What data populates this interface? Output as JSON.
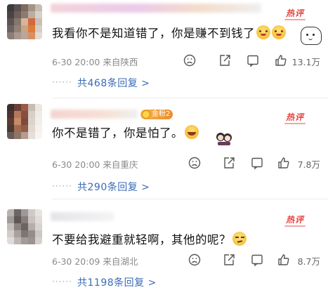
{
  "comments": [
    {
      "text": "我看你不是知道错了，你是赚不到钱了",
      "hot_label": "热评",
      "meta": "6-30 20:00 来自陕西",
      "likes": "13.1万",
      "replies": "共468条回复 >",
      "dots": "······"
    },
    {
      "text": "你不是错了，你是怕了。",
      "hot_label": "热评",
      "badge": "金粉2",
      "meta": "6-30 20:00 来自重庆",
      "likes": "7.8万",
      "replies": "共290条回复 >",
      "dots": "······"
    },
    {
      "text": "不要给我避重就轻啊，其他的呢？",
      "hot_label": "热评",
      "meta": "6-30 20:09 来自湖北",
      "likes": "8.7万",
      "replies": "共1198条回复 >",
      "dots": "······"
    }
  ],
  "colors": {
    "hot": "#e8413b",
    "link": "#3a6bb7",
    "meta": "#8a8a8a"
  },
  "icons": [
    "dislike-face-icon",
    "share-icon",
    "comment-icon",
    "thumbs-up-icon"
  ]
}
